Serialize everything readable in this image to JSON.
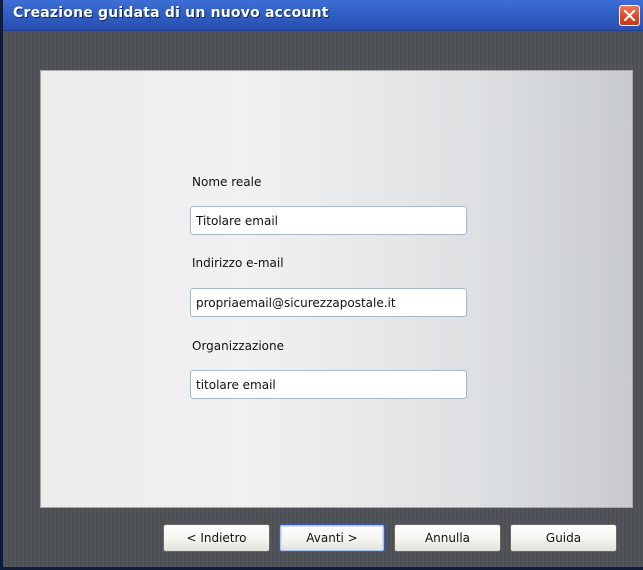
{
  "window": {
    "title": "Creazione guidata di un nuovo account"
  },
  "icons": {
    "close": "close-icon"
  },
  "colors": {
    "titlebar": "#2f5ec3",
    "close_button": "#d9461f",
    "window_background": "#4f5257"
  },
  "form": {
    "fields": [
      {
        "label": "Nome reale",
        "value": "Titolare email"
      },
      {
        "label": "Indirizzo e-mail",
        "value": "propriaemail@sicurezzapostale.it"
      },
      {
        "label": "Organizzazione",
        "value": "titolare email"
      }
    ]
  },
  "buttons": {
    "back": "< Indietro",
    "next": "Avanti >",
    "cancel": "Annulla",
    "help": "Guida"
  }
}
